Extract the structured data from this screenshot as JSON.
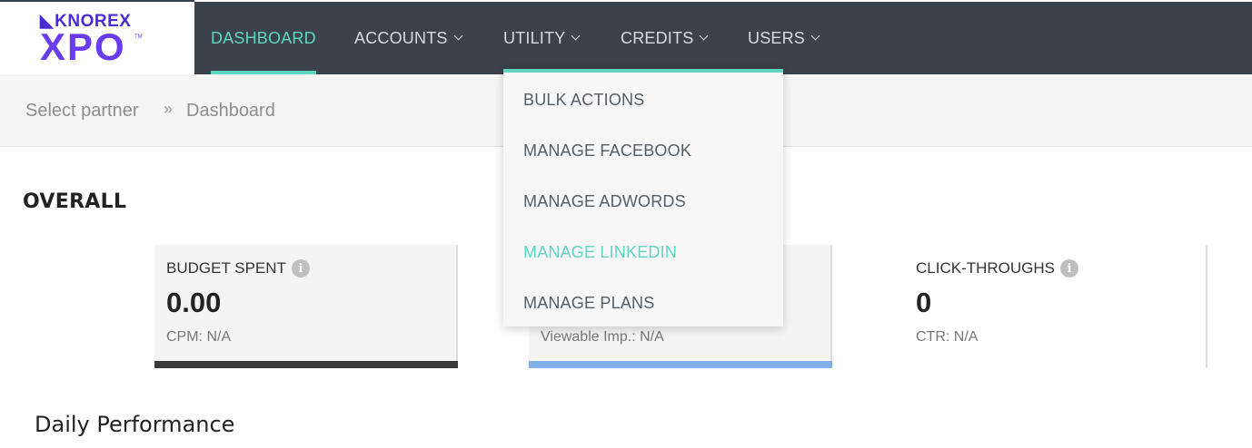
{
  "logo": {
    "brand": "KNOREX",
    "product": "XPO",
    "tm": "TM"
  },
  "nav": {
    "items": [
      {
        "label": "DASHBOARD",
        "active": true,
        "has_dropdown": false
      },
      {
        "label": "ACCOUNTS",
        "active": false,
        "has_dropdown": true
      },
      {
        "label": "UTILITY",
        "active": false,
        "has_dropdown": true
      },
      {
        "label": "CREDITS",
        "active": false,
        "has_dropdown": true
      },
      {
        "label": "USERS",
        "active": false,
        "has_dropdown": true
      }
    ]
  },
  "breadcrumb": {
    "items": [
      "Select partner",
      "Dashboard"
    ],
    "separator": "»"
  },
  "overall": {
    "title": "OVERALL",
    "cards": [
      {
        "label": "BUDGET SPENT",
        "value": "0.00",
        "sub": "CPM: N/A",
        "bar_color": "#3a3a3a"
      },
      {
        "label": "",
        "value": "",
        "sub": "Viewable Imp.: N/A",
        "bar_color": "#7fb0e8"
      },
      {
        "label": "CLICK-THROUGHS",
        "value": "0",
        "sub": "CTR: N/A",
        "bar_color": ""
      }
    ]
  },
  "daily": {
    "title": "Daily Performance"
  },
  "utility_menu": {
    "items": [
      {
        "label": "BULK ACTIONS",
        "hovered": false
      },
      {
        "label": "MANAGE FACEBOOK",
        "hovered": false
      },
      {
        "label": "MANAGE ADWORDS",
        "hovered": false
      },
      {
        "label": "MANAGE LINKEDIN",
        "hovered": true
      },
      {
        "label": "MANAGE PLANS",
        "hovered": false
      }
    ]
  },
  "colors": {
    "accent": "#5fd6c0",
    "navbar": "#3c424b",
    "logo": "#6a3cf0"
  },
  "icons": {
    "info": "info-icon",
    "dropdown": "chevron-down-icon",
    "separator": "double-chevron-right-icon"
  }
}
